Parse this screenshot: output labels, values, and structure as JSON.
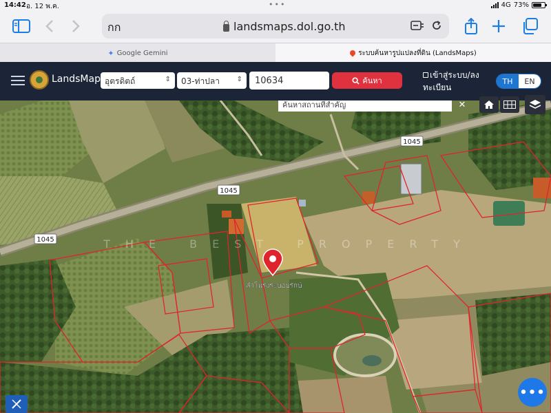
{
  "status_bar": {
    "time": "14:42",
    "date": "อ. 12 พ.ค.",
    "network": "4G",
    "battery": "73%"
  },
  "browser": {
    "url_left_text": "กก",
    "url": "landsmaps.dol.go.th",
    "tabs": [
      {
        "label": "Google Gemini",
        "active": false
      },
      {
        "label": "ระบบค้นหารูปแปลงที่ดิน (LandsMaps)",
        "active": true
      }
    ],
    "icons": {
      "sidebar": "sidebar-icon",
      "back": "chevron-left-icon",
      "forward": "chevron-right-icon",
      "share": "share-icon",
      "new_tab": "plus-icon",
      "tabs": "tabs-icon"
    },
    "accent_color": "#1a7ce8"
  },
  "app": {
    "brand": "LandsMaps",
    "province": "อุตรดิตถ์",
    "district": "03-ท่าปลา",
    "parcel_number": "10634",
    "search_label": "ค้นหา",
    "login_label": "เข้าสู่ระบบ/ลงทะเบียน",
    "lang_th": "TH",
    "lang_en": "EN",
    "header_color": "#1b2537",
    "search_color": "#e0323e"
  },
  "map": {
    "place_search_placeholder": "ค้นหาสถานที่สำคัญ",
    "road_labels": [
      "1045",
      "1045",
      "1045"
    ],
    "watermark": "THE BEST PROPERTY",
    "parcel_label": "ลำโพรงระบอบรักษ์",
    "fab_label": "•••",
    "parcel_line_color": "#e0242c",
    "pin_color": "#e0242c"
  }
}
